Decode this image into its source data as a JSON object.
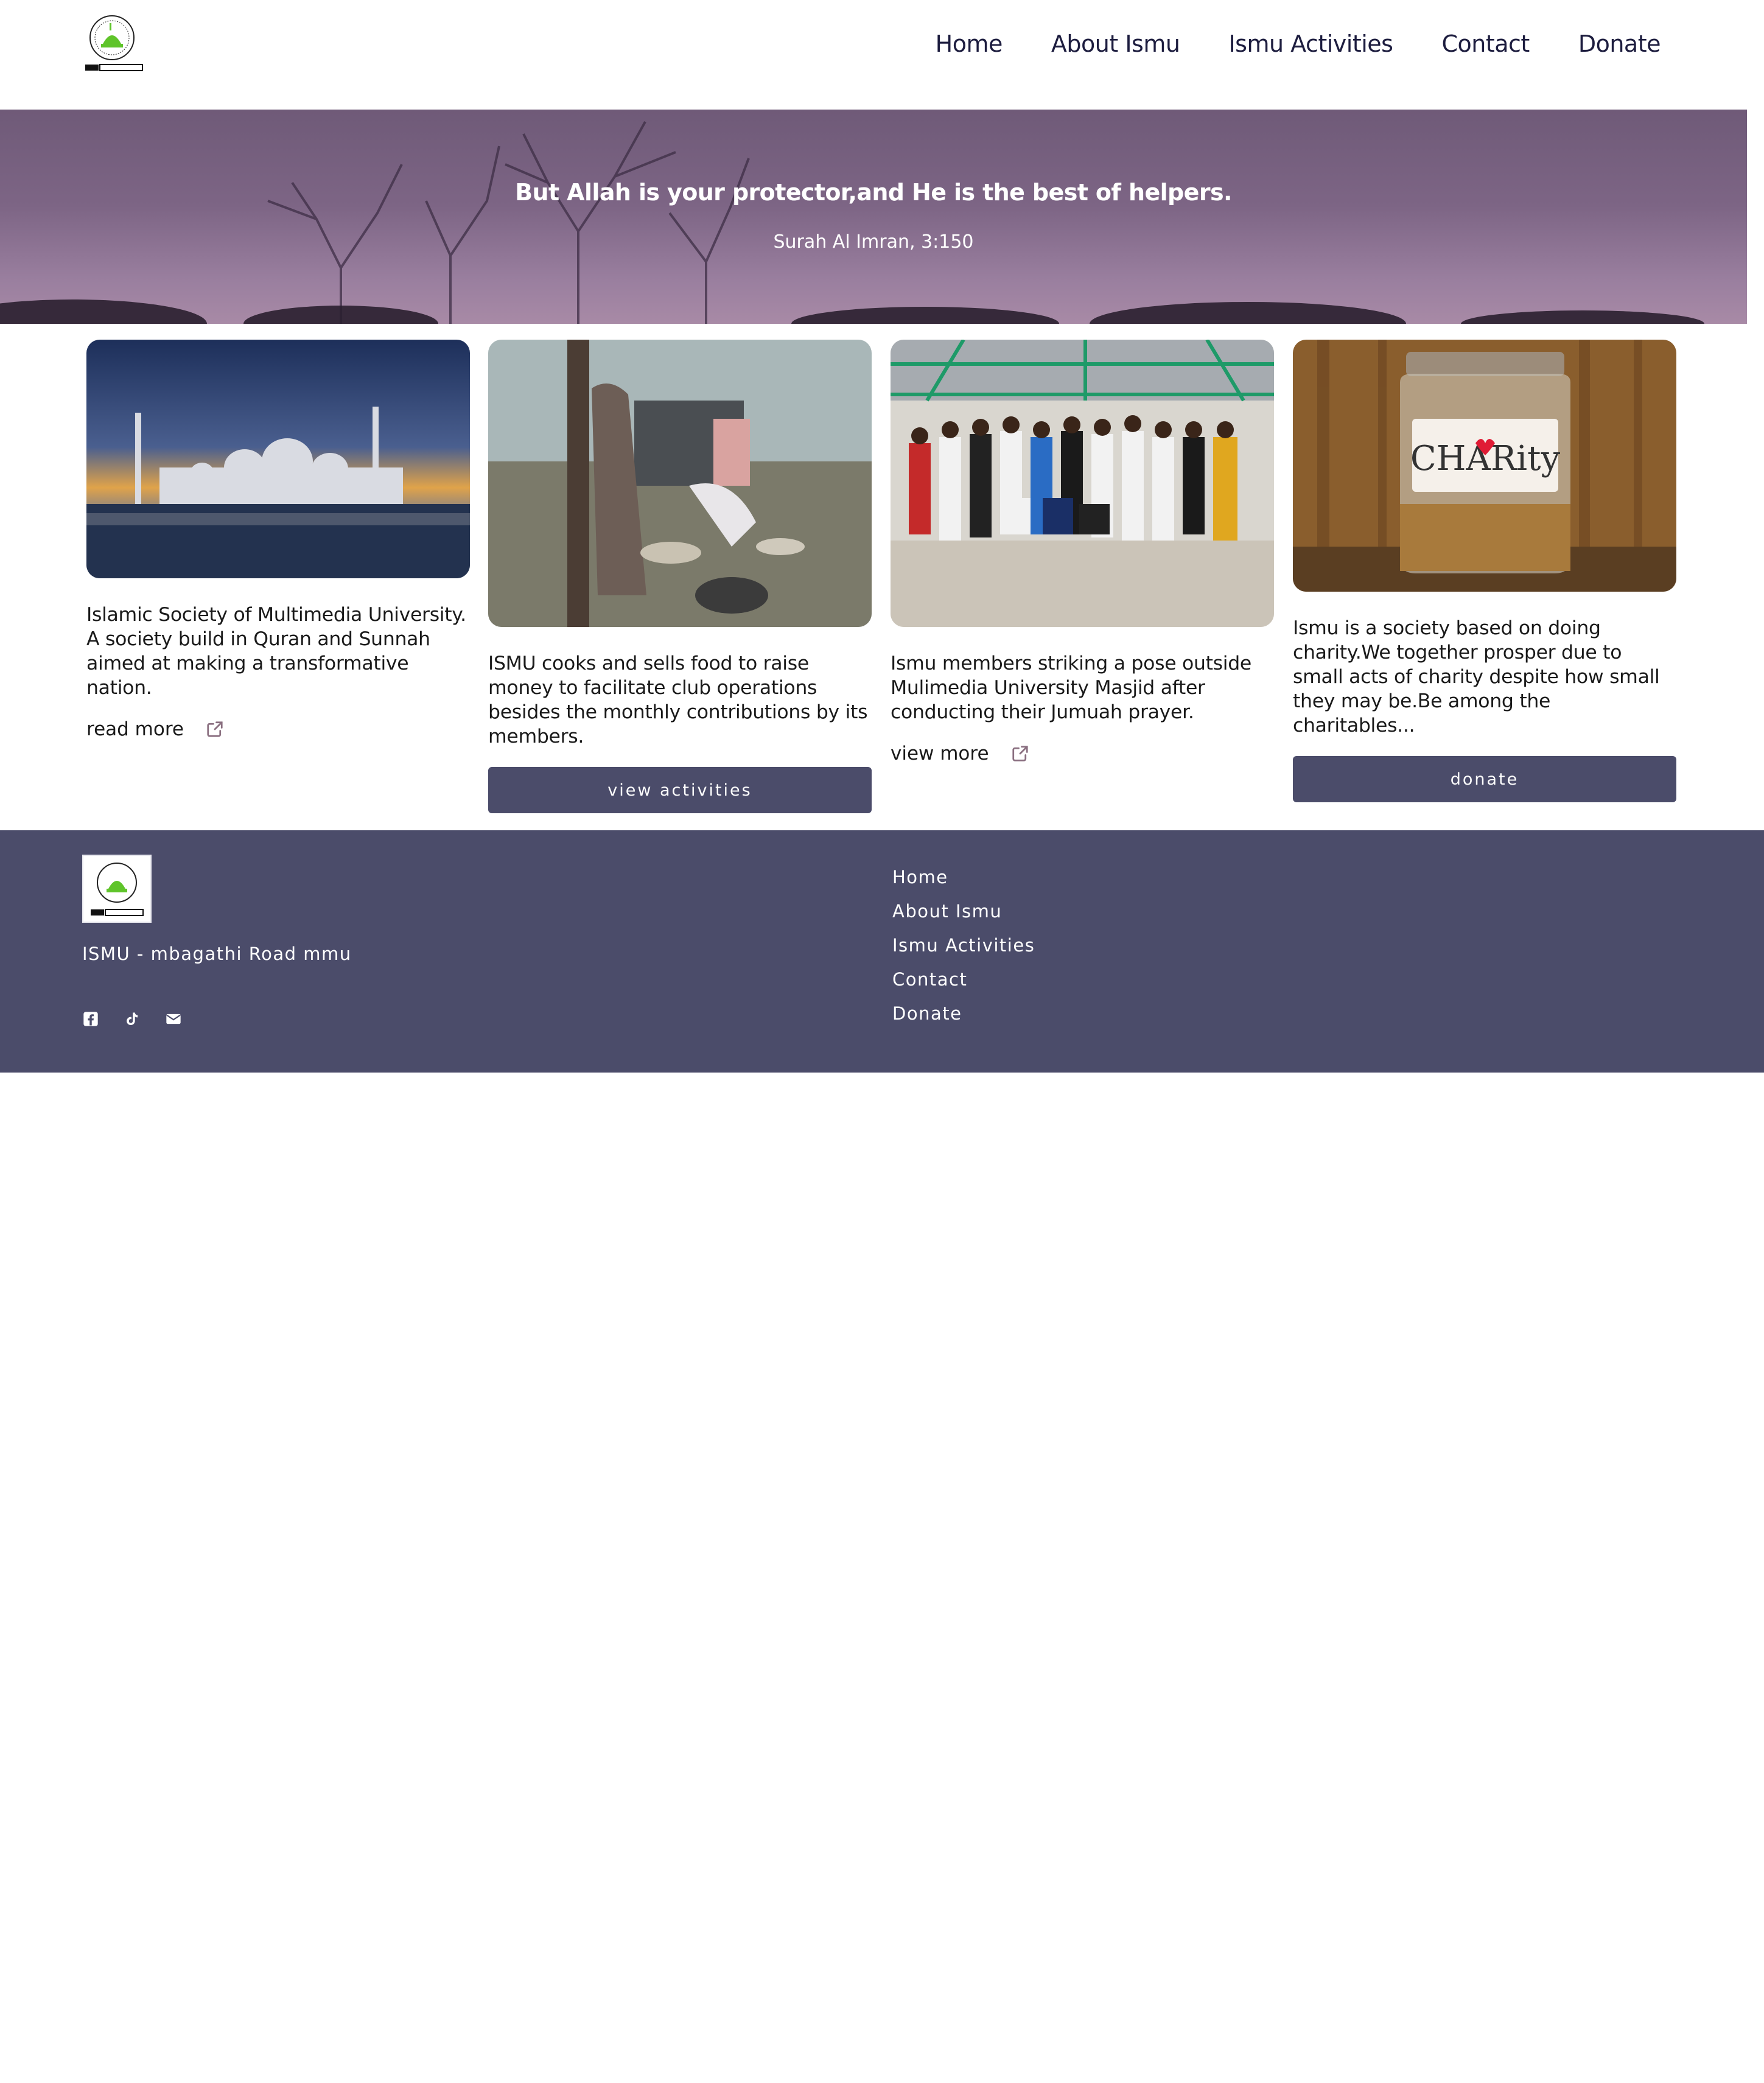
{
  "header": {
    "nav": [
      "Home",
      "About Ismu",
      "Ismu Activities",
      "Contact",
      "Donate"
    ]
  },
  "hero": {
    "quote": "But Allah is your protector,and He is the best of helpers.",
    "reference": "Surah Al Imran, 3:150"
  },
  "cards": [
    {
      "image": "mosque-sunset-photo",
      "text": "Islamic Society of Multimedia University. A society build in Quran and Sunnah aimed at making a transformative nation.",
      "link": "read more"
    },
    {
      "image": "cooking-food-photo",
      "text": "ISMU cooks and sells food to raise money to facilitate club operations besides the monthly contributions by its members.",
      "button": "view activities"
    },
    {
      "image": "group-photo-masjid",
      "text": "Ismu members striking a pose outside Mulimedia University Masjid after conducting their Jumuah prayer.",
      "link": "view more"
    },
    {
      "image": "charity-jar-photo",
      "text": "Ismu is a society based on doing charity.We together prosper due to small acts of charity despite how small they may be.Be among the charitables...",
      "button": "donate"
    }
  ],
  "footer": {
    "address": "ISMU - mbagathi Road mmu",
    "links": [
      "Home",
      "About Ismu",
      "Ismu Activities",
      "Contact",
      "Donate"
    ],
    "socials": [
      "facebook-icon",
      "tiktok-icon",
      "envelope-icon"
    ]
  },
  "colors": {
    "primary": "#4b4c6a",
    "nav_text": "#1d1d3f",
    "logo_green": "#5fc42a"
  }
}
